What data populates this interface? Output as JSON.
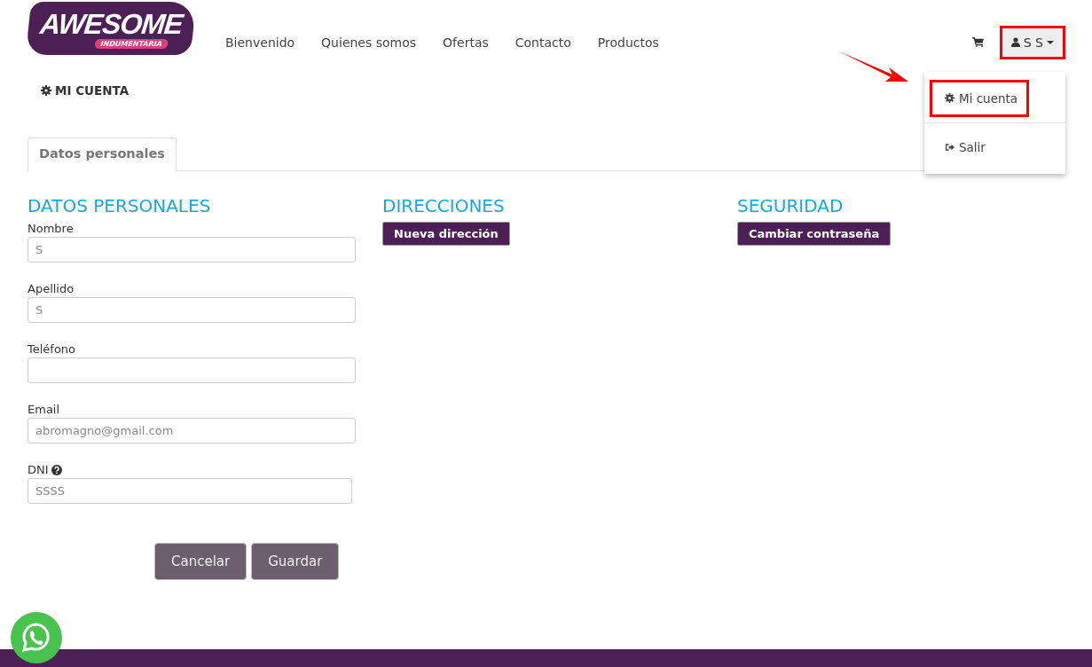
{
  "logo": {
    "title": "AWESOME",
    "subtitle": "INDUMENTARIA"
  },
  "nav": [
    {
      "label": "Bienvenido"
    },
    {
      "label": "Quienes somos"
    },
    {
      "label": "Ofertas"
    },
    {
      "label": "Contacto"
    },
    {
      "label": "Productos"
    }
  ],
  "user_menu": {
    "label": "S S",
    "expanded": true,
    "highlighted": true,
    "items": [
      {
        "kind": "gear",
        "label": "Mi cuenta",
        "highlighted": true
      },
      {
        "kind": "logout",
        "label": "Salir",
        "highlighted": false
      }
    ]
  },
  "page_title": "MI CUENTA",
  "tabs": [
    {
      "label": "Datos personales",
      "selected": true
    }
  ],
  "personal": {
    "heading": "DATOS PERSONALES",
    "fields": [
      {
        "label": "Nombre",
        "value": "S",
        "help": false
      },
      {
        "label": "Apellido",
        "value": "S",
        "help": false
      },
      {
        "label": "Teléfono",
        "help": false
      },
      {
        "label": "Email",
        "value": "abromagno@gmail.com",
        "help": false
      },
      {
        "label": "DNI",
        "value": "SSSS",
        "help": true
      }
    ],
    "buttons": [
      "Cancelar",
      "Guardar"
    ]
  },
  "addresses": {
    "heading": "DIRECCIONES",
    "button": "Nueva dirección"
  },
  "security": {
    "heading": "SEGURIDAD",
    "button": "Cambiar contraseña"
  }
}
